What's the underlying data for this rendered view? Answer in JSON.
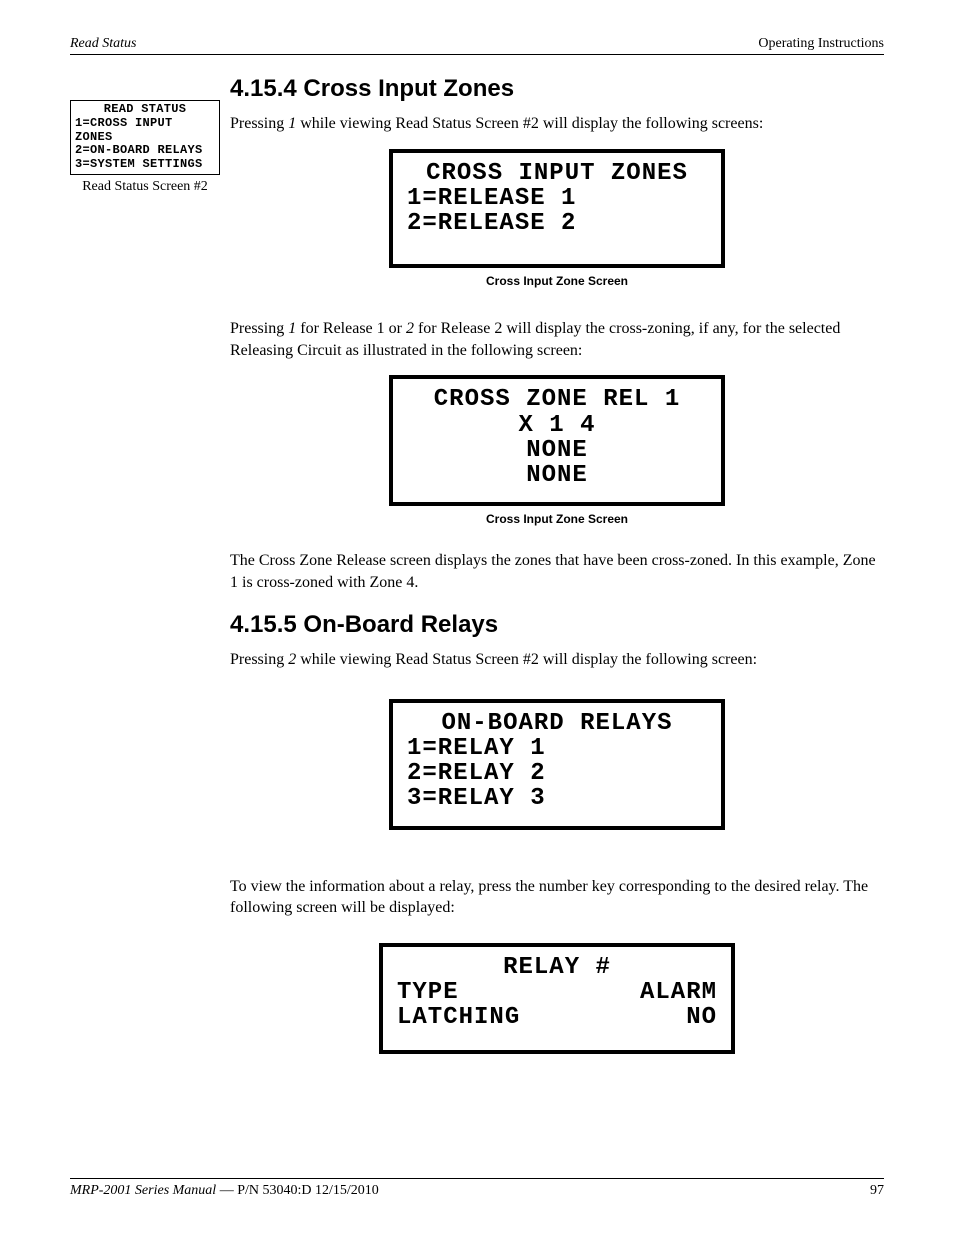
{
  "runhead": {
    "left": "Read Status",
    "right": "Operating Instructions"
  },
  "sidebar": {
    "box": {
      "title": "READ STATUS",
      "line1": "1=CROSS INPUT ZONES",
      "line2": "2=ON-BOARD RELAYS",
      "line3": "3=SYSTEM SETTINGS"
    },
    "caption": "Read Status Screen #2"
  },
  "sections": {
    "s1": {
      "heading": "4.15.4  Cross Input Zones",
      "p1a": "Pressing ",
      "p1k": "1",
      "p1b": " while viewing Read Status Screen #2 will display the following screens:",
      "lcd1": {
        "l1": "CROSS INPUT ZONES",
        "l2": "1=RELEASE 1",
        "l3": "2=RELEASE 2",
        "caption": "Cross Input Zone Screen"
      },
      "p2a": "Pressing ",
      "p2k1": "1",
      "p2b": " for Release 1 or ",
      "p2k2": "2",
      "p2c": " for Release 2 will display the cross-zoning, if any, for the selected Releasing Circuit as illustrated in the following screen:",
      "lcd2": {
        "l1": "CROSS ZONE REL 1",
        "l2": "X 1 4",
        "l3": "NONE",
        "l4": "NONE",
        "caption": "Cross Input Zone Screen"
      },
      "p3": "The Cross Zone Release screen displays the zones that have been cross-zoned.  In this example, Zone 1 is cross-zoned with Zone 4."
    },
    "s2": {
      "heading": "4.15.5  On-Board Relays",
      "p1a": "Pressing ",
      "p1k": "2",
      "p1b": " while viewing Read Status Screen #2 will display the following screen:",
      "lcd1": {
        "l1": "ON-BOARD RELAYS",
        "l2": "1=RELAY 1",
        "l3": "2=RELAY 2",
        "l4": "3=RELAY 3"
      },
      "p2": "To view the information about a relay, press the number key corresponding to the desired relay.  The following screen will be displayed:",
      "lcd2": {
        "l1": "RELAY #",
        "r2a": "TYPE",
        "r2b": "ALARM",
        "r3a": "LATCHING",
        "r3b": "NO"
      }
    }
  },
  "footer": {
    "manual": "MRP-2001 Series Manual",
    "sep": " — ",
    "pn": "P/N 53040:D  12/15/2010",
    "page": "97"
  }
}
